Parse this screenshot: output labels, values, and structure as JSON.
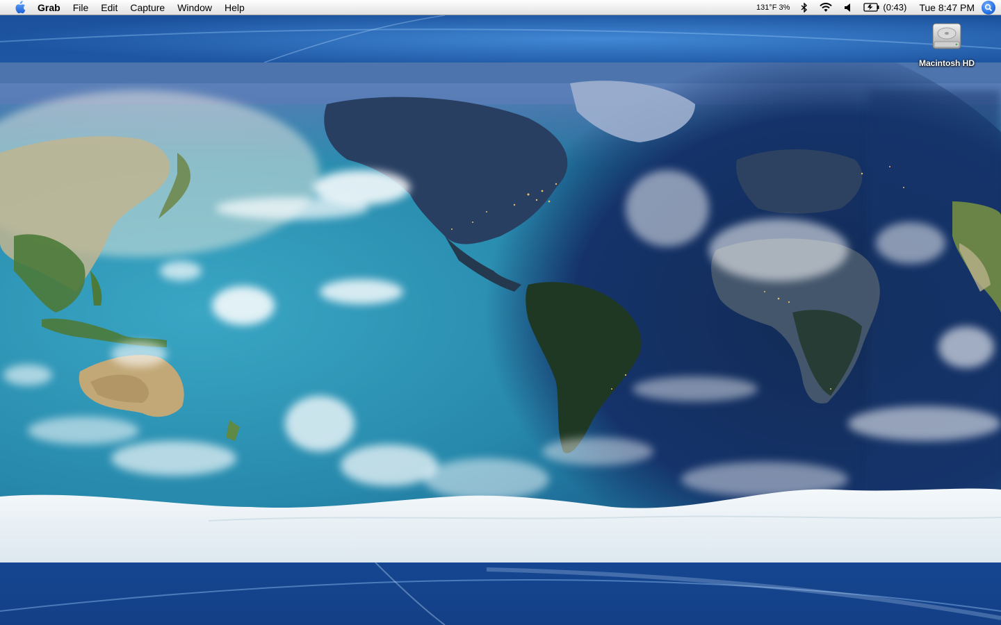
{
  "menubar": {
    "apple_icon": "apple-logo-icon",
    "app_name": "Grab",
    "menus": [
      "File",
      "Edit",
      "Capture",
      "Window",
      "Help"
    ],
    "status": {
      "temperature_cpu": "131°F 3%",
      "bluetooth_icon": "bluetooth-icon",
      "wifi_icon": "wifi-icon",
      "volume_icon": "volume-icon",
      "battery_icon": "battery-charging-icon",
      "battery_time": "(0:43)",
      "clock": "Tue 8:47 PM",
      "spotlight_icon": "spotlight-search-icon"
    }
  },
  "desktop": {
    "icons": [
      {
        "label": "Macintosh HD",
        "icon": "hard-drive-icon"
      }
    ],
    "wallpaper": "world-map-day-night",
    "colors": {
      "background_blue": "#1c55a8",
      "ocean_day": "#2b8fb0",
      "ocean_night": "#12315e",
      "ice": "#e8f1f6"
    }
  }
}
